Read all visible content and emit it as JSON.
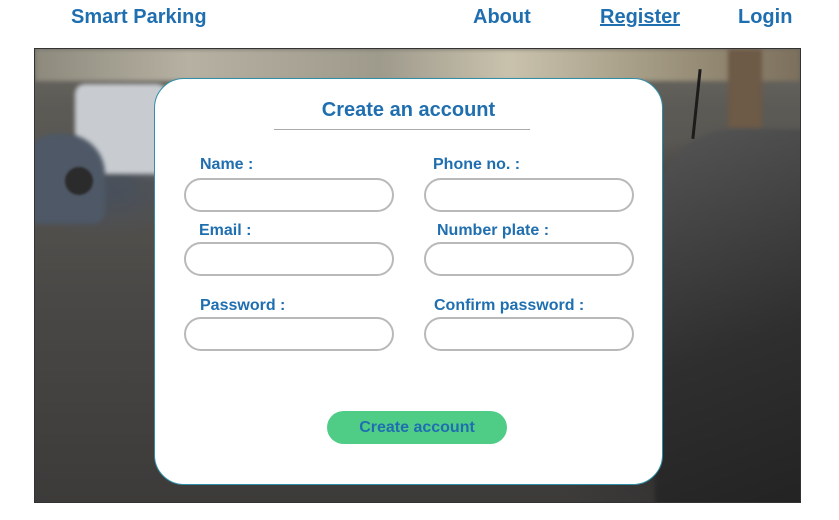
{
  "nav": {
    "brand": "Smart Parking",
    "about": "About",
    "register": "Register",
    "login": "Login"
  },
  "form": {
    "title": "Create an account",
    "fields": {
      "name": {
        "label": "Name :",
        "value": ""
      },
      "phone": {
        "label": "Phone no. :",
        "value": ""
      },
      "email": {
        "label": "Email :",
        "value": ""
      },
      "number_plate": {
        "label": "Number plate :",
        "value": ""
      },
      "password": {
        "label": "Password :",
        "value": ""
      },
      "confirm_password": {
        "label": "Confirm password :",
        "value": ""
      }
    },
    "submit_label": "Create account"
  },
  "colors": {
    "accent_text": "#1f6fb0",
    "button_bg": "#4fcd86",
    "input_border": "#b9b9b9",
    "card_border": "#2f8fa8"
  }
}
